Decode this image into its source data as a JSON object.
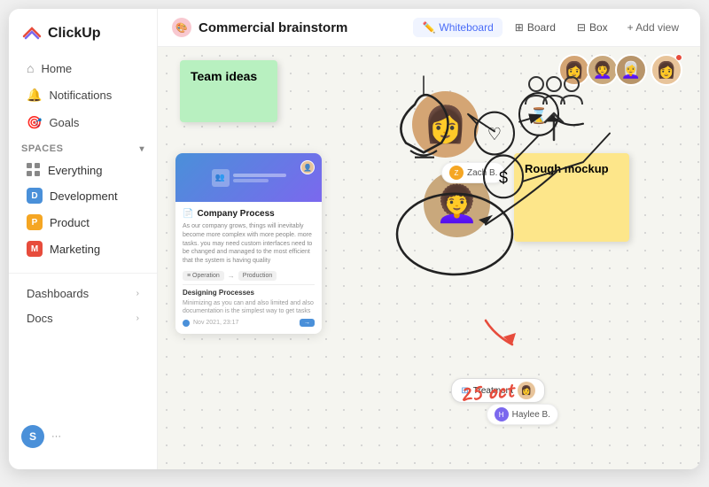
{
  "app": {
    "name": "ClickUp"
  },
  "nav": {
    "home_label": "Home",
    "notifications_label": "Notifications",
    "goals_label": "Goals",
    "spaces_label": "Spaces"
  },
  "spaces": [
    {
      "id": "everything",
      "label": "Everything",
      "type": "grid"
    },
    {
      "id": "development",
      "label": "Development",
      "type": "D",
      "color": "#4a90d9"
    },
    {
      "id": "product",
      "label": "Product",
      "type": "P",
      "color": "#f5a623"
    },
    {
      "id": "marketing",
      "label": "Marketing",
      "type": "M",
      "color": "#e74c3c"
    }
  ],
  "sidebar_bottom": [
    {
      "label": "Dashboards"
    },
    {
      "label": "Docs"
    }
  ],
  "page": {
    "title": "Commercial brainstorm",
    "icon": "🎨"
  },
  "views": [
    {
      "label": "Whiteboard",
      "icon": "✏️",
      "active": true
    },
    {
      "label": "Board",
      "icon": "⊞",
      "active": false
    },
    {
      "label": "Box",
      "icon": "⊟",
      "active": false
    }
  ],
  "add_view": "+ Add view",
  "canvas": {
    "sticky_green": {
      "text": "Team ideas"
    },
    "sticky_yellow": {
      "text": "Rough mockup"
    },
    "doc_title": "Company Process",
    "doc_desc": "As our company grows, things will inevitably become more complex with more people. more tasks. you may need custom interfaces need to be changed and managed to the most efficient that the system is having quality",
    "doc_subtitle": "Designing Processes",
    "doc_subdesc": "Minimizing as you can and also limited and also documentation is the simplest way to get tasks",
    "date_annotation": "25 oct",
    "person_name1": "Zach B.",
    "person_name2": "Haylee B.",
    "tag_label": "Treatment"
  },
  "user": {
    "initial": "S",
    "color": "#4a90d9"
  }
}
